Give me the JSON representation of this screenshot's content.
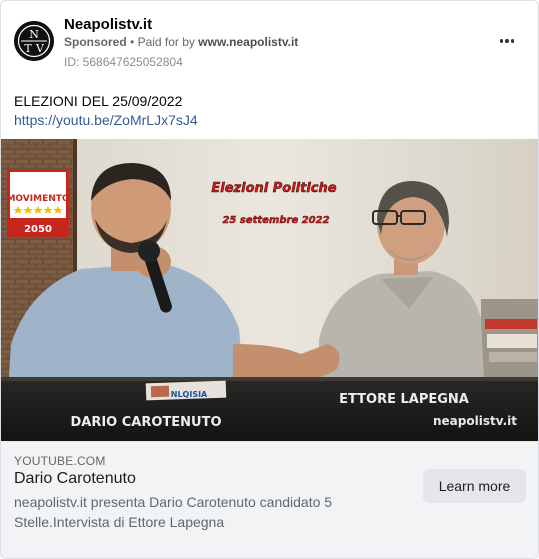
{
  "post": {
    "page_name": "Neapolistv.it",
    "sponsored_label": "Sponsored",
    "separator": "•",
    "paid_for_label": "Paid for by",
    "paid_for_entity": "www.neapolistv.it",
    "ad_id": "ID: 568647625052804",
    "avatar_letters": [
      "N",
      "T",
      "V"
    ],
    "more_icon": "ellipsis-icon"
  },
  "content": {
    "text": "ELEZIONI DEL 25/09/2022",
    "link": "https://youtu.be/ZoMrLJx7sJ4"
  },
  "video": {
    "title_line1": "Elezioni Politiche",
    "title_line2": "25 settembre 2022",
    "name_left": "DARIO CAROTENUTO",
    "name_right": "ETTORE LAPEGNA",
    "watermark": "neapolistv.it",
    "logo_top": "MOVIMENTO",
    "logo_year": "2050",
    "magazine_text": "NLQISIA"
  },
  "link_preview": {
    "domain": "YOUTUBE.COM",
    "title": "Dario Carotenuto",
    "description": "neapolistv.it presenta Dario Carotenuto candidato 5 Stelle.Intervista di Ettore Lapegna",
    "cta_label": "Learn more"
  }
}
